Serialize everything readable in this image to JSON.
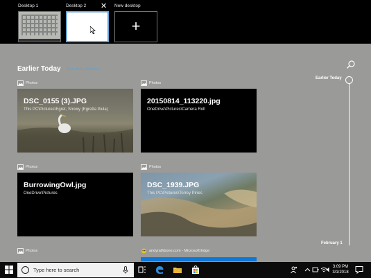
{
  "desktops": [
    {
      "label": "Desktop 1"
    },
    {
      "label": "Desktop 2",
      "close_glyph": "✕"
    },
    {
      "label": "New desktop",
      "add_glyph": "+"
    }
  ],
  "timeline": {
    "section_title": "Earlier Today",
    "see_all": "See all 11 activities",
    "markers": [
      "Earlier Today",
      "February 1"
    ]
  },
  "activities": [
    {
      "app": "Photos",
      "title": "DSC_0155 (3).JPG",
      "path": "This PC\\Pictures\\Egret, Snowy (Egretta thula)"
    },
    {
      "app": "Photos",
      "title": "20150814_113220.jpg",
      "path": "OneDrive\\Pictures\\Camera Roll"
    },
    {
      "app": "Photos",
      "title": "BurrowingOwl.jpg",
      "path": "OneDrive\\Pictures"
    },
    {
      "app": "Photos",
      "title": "DSC_1939.JPG",
      "path": "This PC\\Pictures\\Torrey Pines"
    },
    {
      "app": "Photos"
    },
    {
      "app": "andyrathbone.com - Microsoft Edge"
    }
  ],
  "taskbar": {
    "search_placeholder": "Type here to search",
    "time": "3:09 PM",
    "date": "3/1/2018"
  },
  "colors": {
    "accent": "#0d78d6",
    "link": "#5ba4d8",
    "panel": "#9a9a98"
  }
}
